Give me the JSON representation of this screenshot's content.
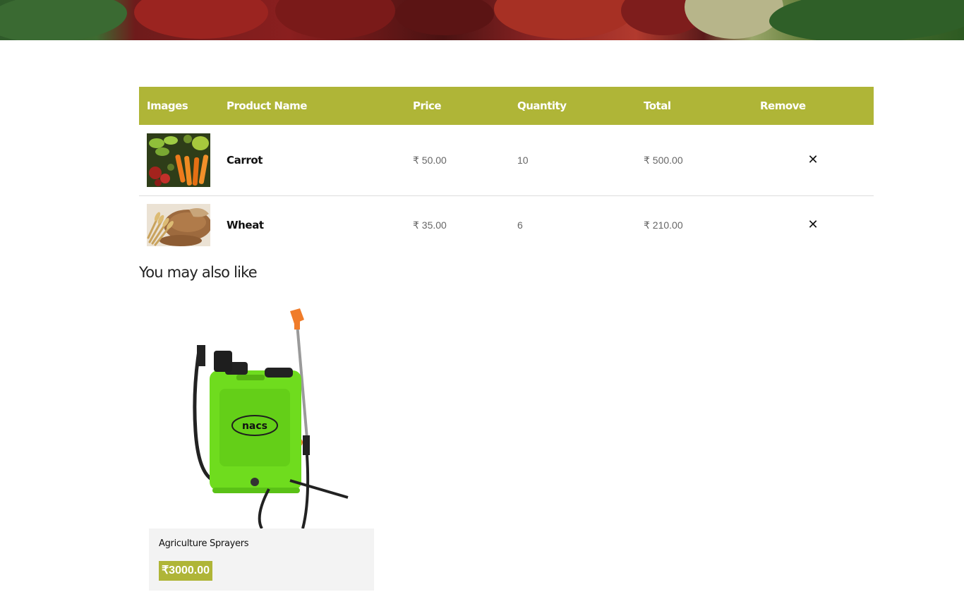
{
  "cart": {
    "headers": [
      "Images",
      "Product Name",
      "Price",
      "Quantity",
      "Total",
      "Remove"
    ],
    "rows": [
      {
        "name": "Carrot",
        "price": "₹ 50.00",
        "quantity": "10",
        "total": "₹ 500.00",
        "remove_icon": "close-icon"
      },
      {
        "name": "Wheat",
        "price": "₹ 35.00",
        "quantity": "6",
        "total": "₹ 210.00",
        "remove_icon": "close-icon"
      }
    ]
  },
  "related": {
    "heading": "You may also like",
    "products": [
      {
        "name": "Agriculture Sprayers",
        "price": "₹3000.00",
        "brand_mark": "nacs"
      }
    ]
  },
  "colors": {
    "accent": "#afb537",
    "sprayer_green": "#6fdc1e",
    "card_bg": "#f3f3f3"
  }
}
